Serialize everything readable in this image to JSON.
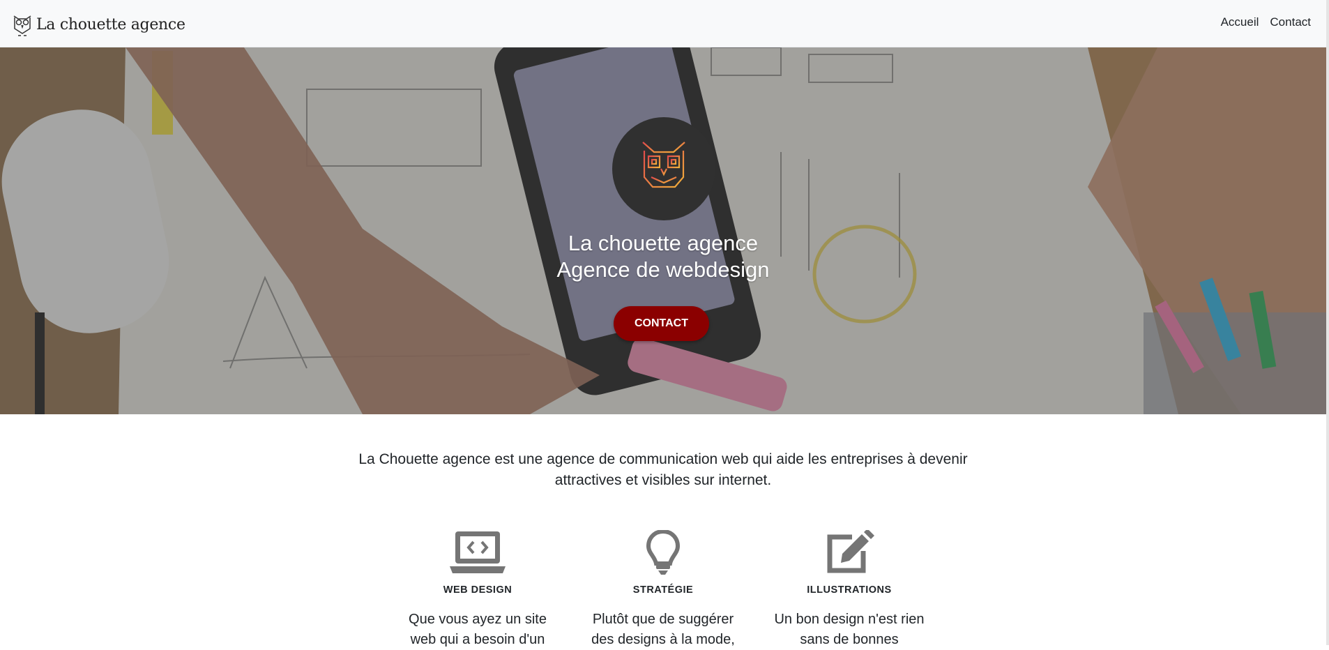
{
  "navbar": {
    "brand": "La chouette agence",
    "links": [
      "Accueil",
      "Contact"
    ]
  },
  "hero": {
    "title_line1": "La chouette agence",
    "title_line2": "Agence de webdesign",
    "cta": "CONTACT"
  },
  "intro": "La Chouette agence est une agence de communication web qui aide les entreprises à devenir attractives et visibles sur internet.",
  "features": [
    {
      "icon": "laptop-code-icon",
      "title": "WEB DESIGN",
      "text": "Que vous ayez un site web qui a besoin d'un"
    },
    {
      "icon": "lightbulb-icon",
      "title": "STRATÉGIE",
      "text": "Plutôt que de suggérer des designs à la mode,"
    },
    {
      "icon": "edit-icon",
      "title": "ILLUSTRATIONS",
      "text": "Un bon design n'est rien sans de bonnes"
    }
  ],
  "colors": {
    "cta": "#8b0000",
    "navbar_bg": "#f8f9fa",
    "logo_circle": "#303030",
    "icon_gray": "#757575"
  }
}
